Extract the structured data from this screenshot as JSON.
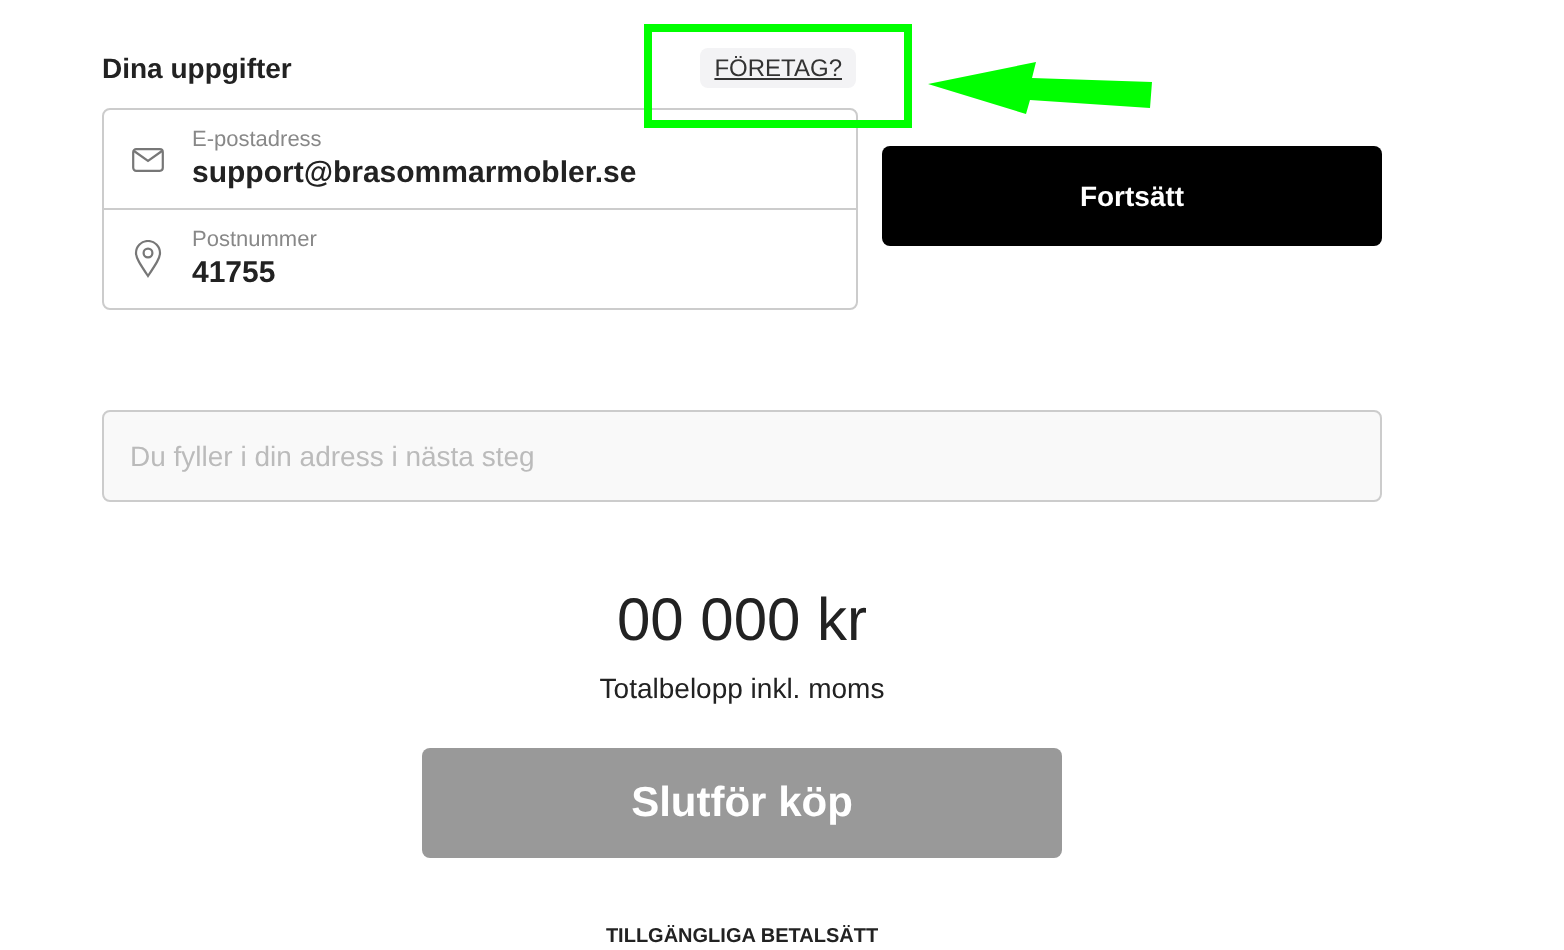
{
  "section": {
    "title": "Dina uppgifter",
    "company_link": "FÖRETAG?"
  },
  "fields": [
    {
      "kind": "email",
      "label": "E-postadress",
      "value": "support@brasommarmobler.se"
    },
    {
      "kind": "postcode",
      "label": "Postnummer",
      "value": "41755"
    }
  ],
  "continue_button": {
    "label": "Fortsätt",
    "disabled": false
  },
  "address_field": {
    "placeholder": "Du fyller i din adress i nästa steg"
  },
  "total": {
    "amount": "00 000 kr",
    "caption": "Totalbelopp inkl. moms"
  },
  "purchase_button": {
    "label": "Slutför köp",
    "disabled": true
  },
  "footer_heading": "TILLGÄNGLIGA BETALSÄTT",
  "annotation": {
    "highlight": true,
    "arrow": true
  }
}
